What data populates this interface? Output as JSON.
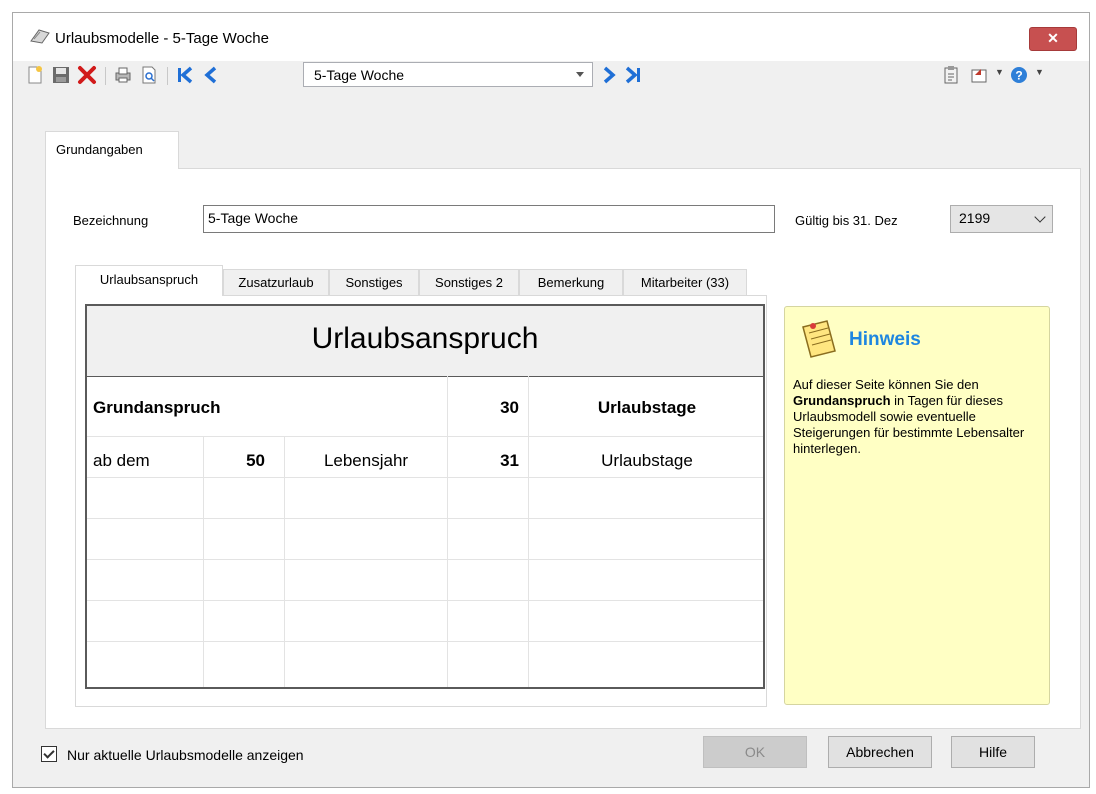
{
  "window": {
    "title": "Urlaubsmodelle - 5-Tage Woche",
    "close_icon": "close-icon"
  },
  "toolbar": {
    "record_combo_value": "5-Tage Woche",
    "icons": [
      "new-document-icon",
      "save-icon",
      "delete-icon",
      "print-icon",
      "print-preview-icon",
      "first-record-icon",
      "previous-record-icon",
      "next-record-icon",
      "last-record-icon",
      "clipboard-icon",
      "export-icon",
      "help-icon"
    ]
  },
  "main_tabs": [
    {
      "label": "Grundangaben"
    }
  ],
  "form": {
    "bezeichnung_label": "Bezeichnung",
    "bezeichnung_value": "5-Tage Woche",
    "gueltig_label": "Gültig bis 31. Dez",
    "gueltig_value": "2199"
  },
  "sub_tabs": [
    {
      "label": "Urlaubsanspruch"
    },
    {
      "label": "Zusatzurlaub"
    },
    {
      "label": "Sonstiges"
    },
    {
      "label": "Sonstiges 2"
    },
    {
      "label": "Bemerkung"
    },
    {
      "label": "Mitarbeiter (33)"
    }
  ],
  "grid": {
    "header": "Urlaubsanspruch",
    "row_basic": {
      "label": "Grundanspruch",
      "value": "30",
      "unit": "Urlaubstage"
    },
    "rows": [
      {
        "prefix": "ab dem",
        "age": "50",
        "age_unit": "Lebensjahr",
        "days": "31",
        "days_unit": "Urlaubstage"
      }
    ]
  },
  "hint": {
    "title": "Hinweis",
    "text_before": "Auf dieser Seite können Sie den ",
    "text_bold": "Grundanspruch",
    "text_after": " in Tagen für dieses Urlaubsmodell sowie eventuelle Steigerungen für bestimmte Lebensalter hinterlegen."
  },
  "footer": {
    "checkbox_label": "Nur aktuelle Urlaubsmodelle anzeigen",
    "checkbox_checked": true,
    "ok_label": "OK",
    "cancel_label": "Abbrechen",
    "help_label": "Hilfe"
  },
  "colors": {
    "hint_background": "#ffffc4",
    "hint_title": "#1e86e0",
    "close_button": "#c75050"
  }
}
